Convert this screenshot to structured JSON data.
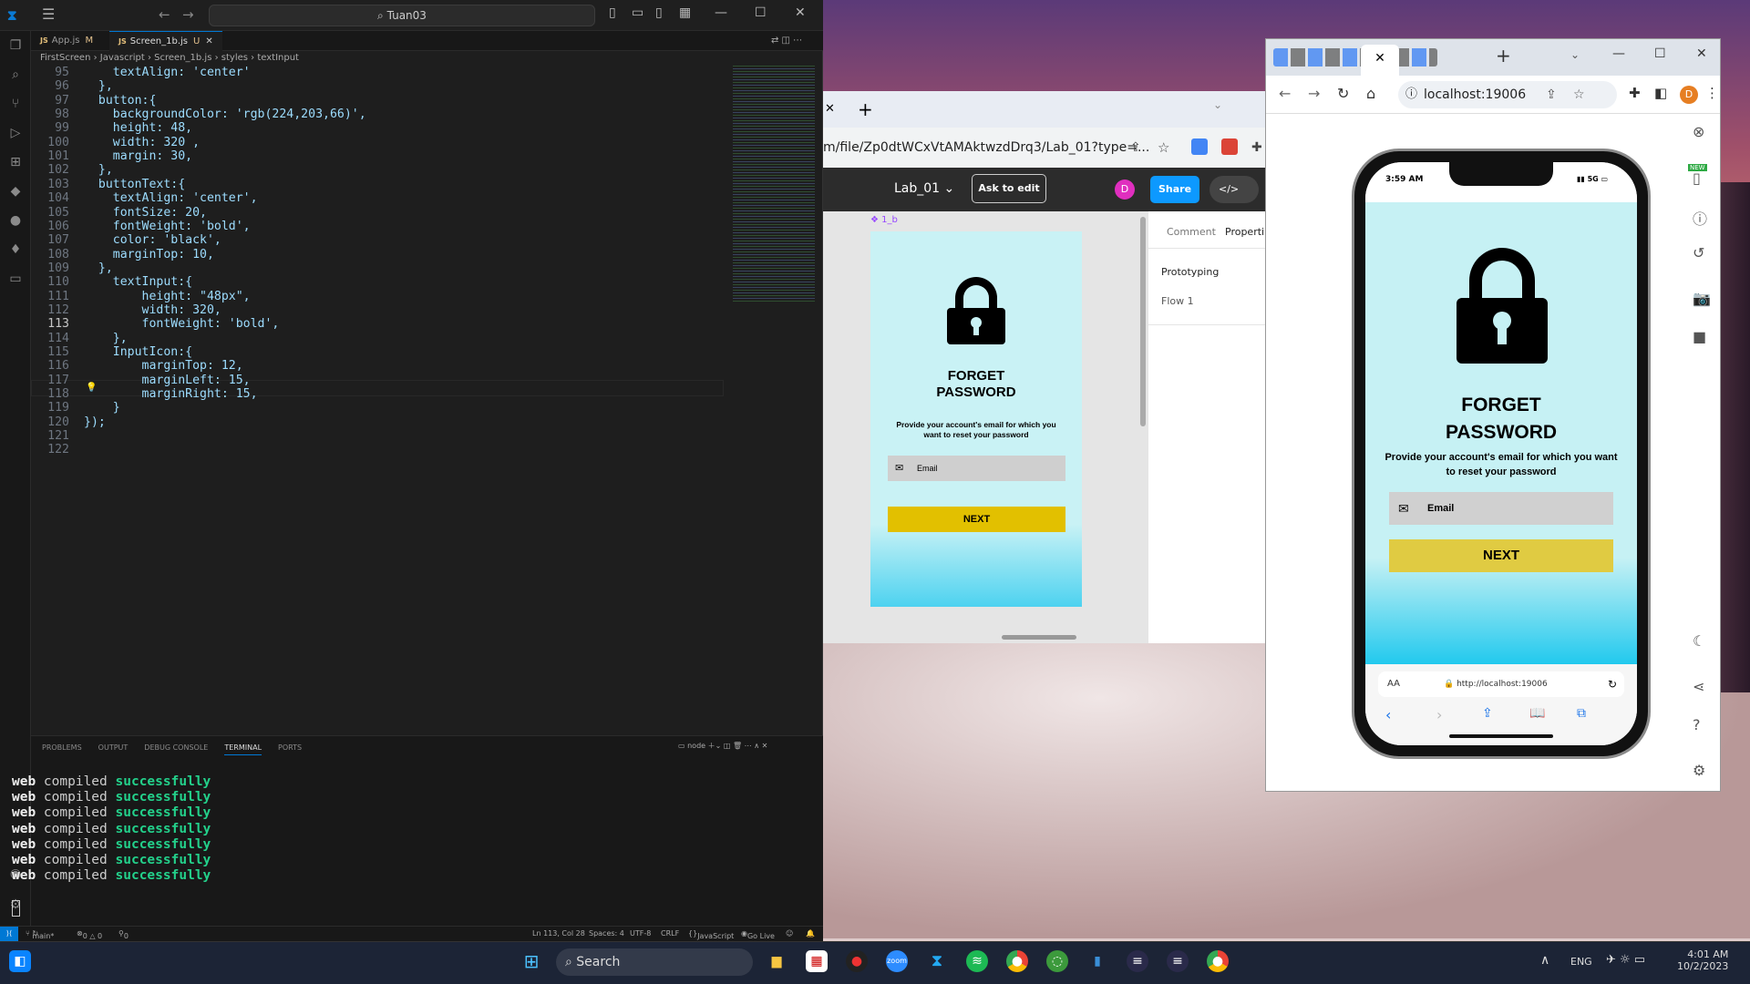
{
  "vscode": {
    "search_text": "Tuan03",
    "tabs": [
      {
        "label": "App.js",
        "badge": "M"
      },
      {
        "label": "Screen_1b.js",
        "badge": "U"
      }
    ],
    "breadcrumb": [
      "FirstScreen",
      "Javascript",
      "Screen_1b.js",
      "styles",
      "textInput"
    ],
    "code_lines": [
      {
        "n": "95",
        "text": "    textAlign: 'center'"
      },
      {
        "n": "96",
        "text": "  },"
      },
      {
        "n": "97",
        "text": "  button:{"
      },
      {
        "n": "98",
        "text": "    backgroundColor: 'rgb(224,203,66)',"
      },
      {
        "n": "99",
        "text": "    height: 48,"
      },
      {
        "n": "100",
        "text": "    width: 320 ,"
      },
      {
        "n": "101",
        "text": "    margin: 30,"
      },
      {
        "n": "102",
        "text": "  },"
      },
      {
        "n": "103",
        "text": "  buttonText:{"
      },
      {
        "n": "104",
        "text": "    textAlign: 'center',"
      },
      {
        "n": "105",
        "text": "    fontSize: 20,"
      },
      {
        "n": "106",
        "text": "    fontWeight: 'bold',"
      },
      {
        "n": "107",
        "text": "    color: 'black',"
      },
      {
        "n": "108",
        "text": "    marginTop: 10,"
      },
      {
        "n": "109",
        "text": "  },"
      },
      {
        "n": "110",
        "text": "    textInput:{"
      },
      {
        "n": "111",
        "text": "        height: \"48px\","
      },
      {
        "n": "112",
        "text": "        width: 320,"
      },
      {
        "n": "113",
        "text": "        fontWeight: 'bold',"
      },
      {
        "n": "114",
        "text": "    },"
      },
      {
        "n": "115",
        "text": "    InputIcon:{"
      },
      {
        "n": "116",
        "text": "        marginTop: 12,"
      },
      {
        "n": "117",
        "text": "        marginLeft: 15,"
      },
      {
        "n": "118",
        "text": "        marginRight: 15,"
      },
      {
        "n": "119",
        "text": "    }"
      },
      {
        "n": "120",
        "text": "});"
      },
      {
        "n": "121",
        "text": ""
      },
      {
        "n": "122",
        "text": ""
      }
    ],
    "current_line": "113",
    "panel_tabs": [
      "PROBLEMS",
      "OUTPUT",
      "DEBUG CONSOLE",
      "TERMINAL",
      "PORTS"
    ],
    "active_panel_tab": "TERMINAL",
    "terminal_shell": "node",
    "terminal_lines": [
      {
        "w1": "web",
        "w2": "compiled",
        "w3": "successfully"
      },
      {
        "w1": "web",
        "w2": "compiled",
        "w3": "successfully"
      },
      {
        "w1": "web",
        "w2": "compiled",
        "w3": "successfully"
      },
      {
        "w1": "web",
        "w2": "compiled",
        "w3": "successfully"
      },
      {
        "w1": "web",
        "w2": "compiled",
        "w3": "successfully"
      },
      {
        "w1": "web",
        "w2": "compiled",
        "w3": "successfully"
      },
      {
        "w1": "web",
        "w2": "compiled",
        "w3": "successfully"
      }
    ],
    "status": {
      "branch": "main*",
      "problems": "0 △ 0",
      "ports": "0",
      "position": "Ln 113, Col 28",
      "spaces": "Spaces: 4",
      "encoding": "UTF-8",
      "eol": "CRLF",
      "language": "JavaScript",
      "golive": "Go Live"
    }
  },
  "figma_browser": {
    "url": "m/file/Zp0dtWCxVtAMAktwzdDrq3/Lab_01?type=...",
    "file_name": "Lab_01",
    "ask_to_edit": "Ask to edit",
    "share": "Share",
    "avatar": "D",
    "frame_label": "1_b",
    "panel_tabs": [
      "Comment",
      "Properti"
    ],
    "prototyping": "Prototyping",
    "flow": "Flow 1",
    "mock": {
      "title_line1": "FORGET",
      "title_line2": "PASSWORD",
      "desc": "Provide your account's email for which you want to reset your password",
      "email": "Email",
      "next": "NEXT"
    }
  },
  "chrome": {
    "url": "localhost:19006",
    "avatar": "D",
    "phone": {
      "time": "3:59 AM",
      "signal": "5G",
      "title_line1": "FORGET",
      "title_line2": "PASSWORD",
      "desc": "Provide your account's email for which you want to reset your password",
      "email": "Email",
      "next": "NEXT",
      "aa": "AA",
      "safari_url": "http://localhost:19006"
    },
    "new_badge": "NEW"
  },
  "taskbar": {
    "search": "Search",
    "lang": "ENG",
    "time": "4:01 AM",
    "date": "10/2/2023"
  }
}
